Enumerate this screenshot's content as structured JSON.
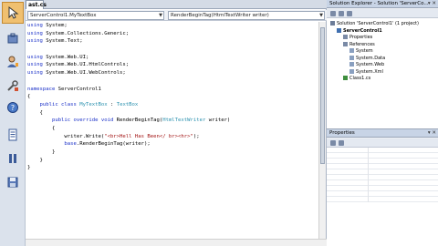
{
  "editor": {
    "doc_tab": "ast.cs",
    "nav_left": "ServerControl1.MyTextBox",
    "nav_right": "RenderBeginTag(HtmlTextWriter writer)",
    "lines": [
      [
        {
          "t": "using",
          "c": "kw"
        },
        {
          "t": " System;"
        }
      ],
      [
        {
          "t": "using",
          "c": "kw"
        },
        {
          "t": " System.Collections.Generic;"
        }
      ],
      [
        {
          "t": "using",
          "c": "kw"
        },
        {
          "t": " System.Text;"
        }
      ],
      [
        {
          "t": ""
        }
      ],
      [
        {
          "t": "using",
          "c": "kw"
        },
        {
          "t": " System.Web.UI;"
        }
      ],
      [
        {
          "t": "using",
          "c": "kw"
        },
        {
          "t": " System.Web.UI.HtmlControls;"
        }
      ],
      [
        {
          "t": "using",
          "c": "kw"
        },
        {
          "t": " System.Web.UI.WebControls;"
        }
      ],
      [
        {
          "t": ""
        }
      ],
      [
        {
          "t": "namespace",
          "c": "kw"
        },
        {
          "t": " ServerControl1"
        }
      ],
      [
        {
          "t": "{"
        }
      ],
      [
        {
          "t": "    "
        },
        {
          "t": "public class",
          "c": "kw"
        },
        {
          "t": " "
        },
        {
          "t": "MyTextBox",
          "c": "ty"
        },
        {
          "t": " : "
        },
        {
          "t": "TextBox",
          "c": "ty"
        }
      ],
      [
        {
          "t": "    {"
        }
      ],
      [
        {
          "t": "        "
        },
        {
          "t": "public override void",
          "c": "kw"
        },
        {
          "t": " RenderBeginTag("
        },
        {
          "t": "HtmlTextWriter",
          "c": "ty"
        },
        {
          "t": " writer)"
        }
      ],
      [
        {
          "t": "        {"
        }
      ],
      [
        {
          "t": "            writer.Write("
        },
        {
          "t": "\"<br>Hell Has Been</ br><hr>\"",
          "c": "st"
        },
        {
          "t": ");"
        }
      ],
      [
        {
          "t": "            "
        },
        {
          "t": "base",
          "c": "kw"
        },
        {
          "t": ".RenderBeginTag(writer);"
        }
      ],
      [
        {
          "t": "        }"
        }
      ],
      [
        {
          "t": "    }"
        }
      ],
      [
        {
          "t": "}"
        }
      ]
    ]
  },
  "solution_explorer": {
    "title": "Solution Explorer - Solution 'ServerCo...",
    "items": [
      {
        "label": "Solution 'ServerControl1' (1 project)",
        "bold": false,
        "indent": 0,
        "color": "#6c7c98"
      },
      {
        "label": "ServerControl1",
        "bold": true,
        "indent": 1,
        "color": "#3f6fb0"
      },
      {
        "label": "Properties",
        "bold": false,
        "indent": 2,
        "color": "#7a8aa6"
      },
      {
        "label": "References",
        "bold": false,
        "indent": 2,
        "color": "#7a8aa6"
      },
      {
        "label": "System",
        "bold": false,
        "indent": 3,
        "color": "#8aa0c0"
      },
      {
        "label": "System.Data",
        "bold": false,
        "indent": 3,
        "color": "#8aa0c0"
      },
      {
        "label": "System.Web",
        "bold": false,
        "indent": 3,
        "color": "#8aa0c0"
      },
      {
        "label": "System.Xml",
        "bold": false,
        "indent": 3,
        "color": "#8aa0c0"
      },
      {
        "label": "Class1.cs",
        "bold": false,
        "indent": 2,
        "color": "#3f8f3f"
      }
    ]
  },
  "properties": {
    "title": "Properties"
  },
  "launcher": {
    "icons": [
      "pointer-tool-icon",
      "toolbox-icon",
      "user-icon",
      "tools-icon",
      "help-icon",
      "document-icon",
      "list-icon",
      "disk-icon"
    ]
  }
}
